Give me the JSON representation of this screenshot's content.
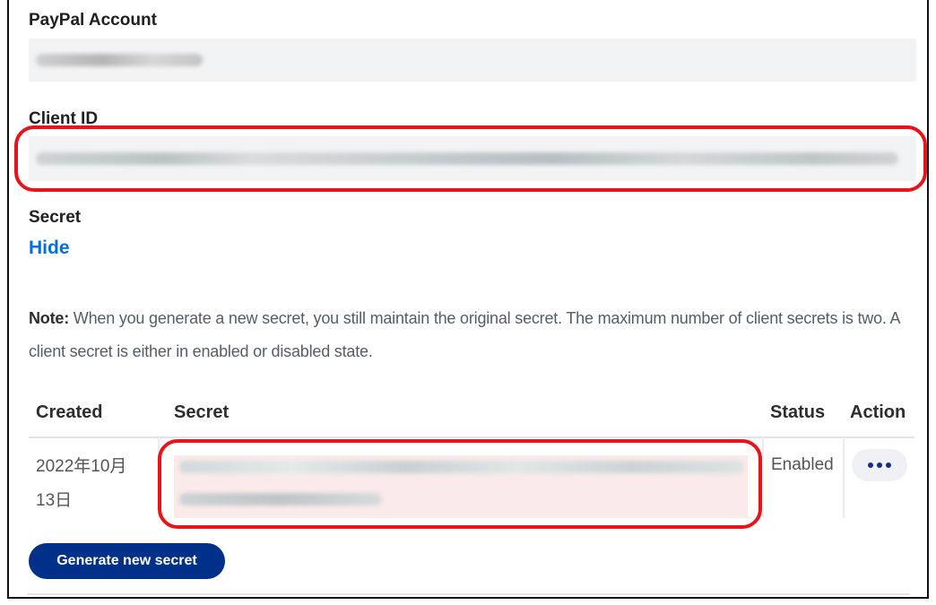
{
  "account": {
    "label": "PayPal Account"
  },
  "client": {
    "label": "Client ID"
  },
  "secret_section": {
    "label": "Secret",
    "toggle_link": "Hide"
  },
  "note": {
    "prefix": "Note:",
    "text": " When you generate a new secret, you still maintain the original secret. The maximum number of client secrets is two. A client secret is either in enabled or disabled state."
  },
  "secrets_table": {
    "headers": {
      "created": "Created",
      "secret": "Secret",
      "status": "Status",
      "action": "Action"
    },
    "rows": [
      {
        "created_line1": "2022年10月",
        "created_line2": "13日",
        "status": "Enabled",
        "action_icon": "more-horizontal-icon"
      }
    ]
  },
  "generate_button": "Generate new secret",
  "colors": {
    "link": "#0070e0",
    "primary_button": "#003087",
    "annotation_red": "#e8141b",
    "field_bg": "#f2f3f5"
  }
}
